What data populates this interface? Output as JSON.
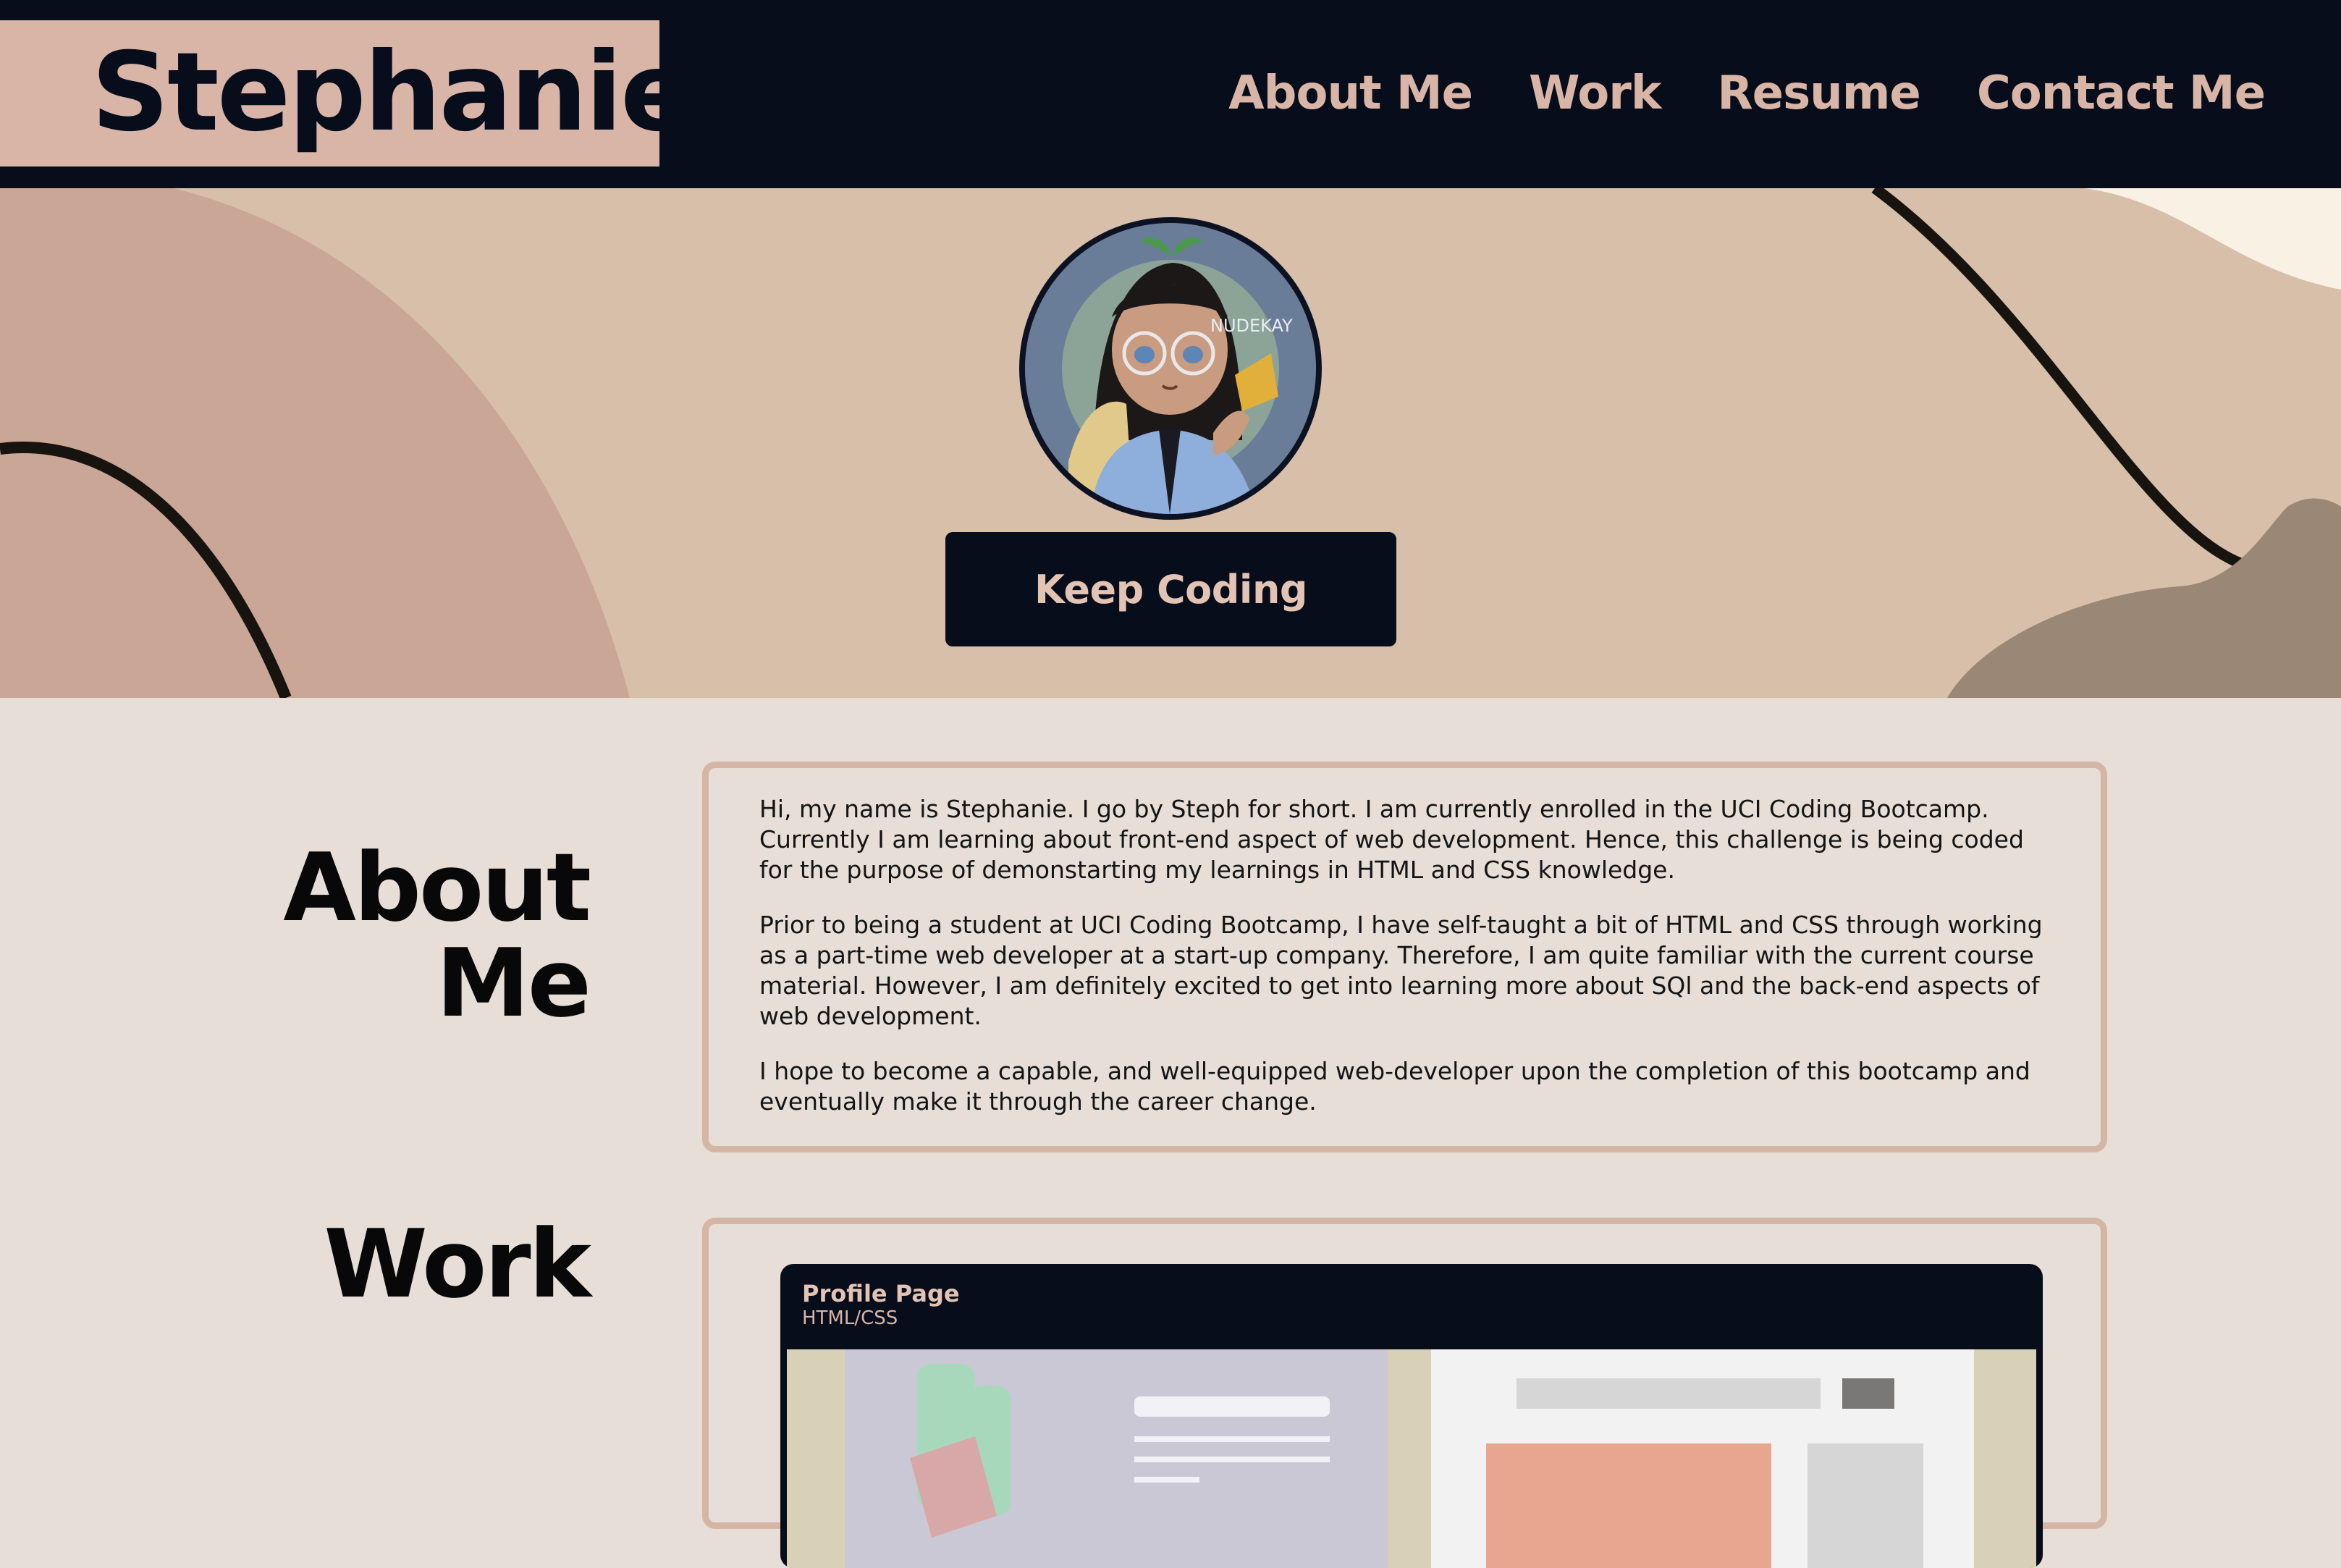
{
  "header": {
    "logo": "Stephanie",
    "nav": [
      "About Me",
      "Work",
      "Resume",
      "Contact Me"
    ]
  },
  "hero": {
    "avatar_watermark": "NUDEKAY",
    "cta_label": "Keep Coding"
  },
  "about": {
    "title_line1": "About",
    "title_line2": "Me",
    "paragraphs": [
      "Hi, my name is Stephanie. I go by Steph for short. I am currently enrolled in the UCI Coding Bootcamp. Currently I am learning about front-end aspect of web development. Hence, this challenge is being coded for the purpose of demonstarting my learnings in HTML and CSS knowledge.",
      "Prior to being a student at UCI Coding Bootcamp, I have self-taught a bit of HTML and CSS through working as a part-time web developer at a start-up company. Therefore, I am quite familiar with the current course material. However, I am definitely excited to get into learning more about SQl and the back-end aspects of web development.",
      "I hope to become a capable, and well-equipped web-developer upon the completion of this bootcamp and eventually make it through the career change."
    ]
  },
  "work": {
    "title": "Work",
    "projects": [
      {
        "title": "Profile Page",
        "subtitle": "HTML/CSS"
      }
    ]
  },
  "colors": {
    "navy": "#080d1c",
    "accent": "#d8b5a6",
    "background": "#e6ded7",
    "hero": "#d8bfa9"
  }
}
